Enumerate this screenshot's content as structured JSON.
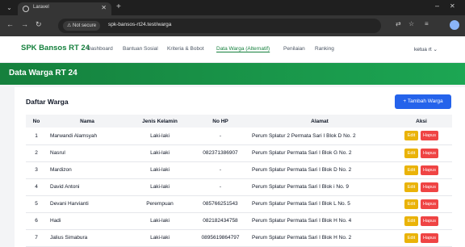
{
  "browser": {
    "tab_title": "Laravel",
    "security_label": "Not secure",
    "url": "spk-bansos-rt24.test/warga"
  },
  "nav": {
    "brand": "SPK Bansos RT 24",
    "links": [
      {
        "label": "Dashboard",
        "active": false
      },
      {
        "label": "Bantuan Sosial",
        "active": false
      },
      {
        "label": "Kriteria & Bobot",
        "active": false
      },
      {
        "label": "Data Warga (Alternatif)",
        "active": true
      },
      {
        "label": "Penilaian",
        "active": false
      },
      {
        "label": "Ranking",
        "active": false
      }
    ],
    "user": "ketua rt"
  },
  "header": {
    "title": "Data Warga RT 24"
  },
  "card": {
    "title": "Daftar Warga",
    "add_button": "+ Tambah Warga",
    "columns": [
      "No",
      "Nama",
      "Jenis Kelamin",
      "No HP",
      "Alamat",
      "Aksi"
    ],
    "edit_label": "Edit",
    "delete_label": "Hapus",
    "rows": [
      {
        "no": "1",
        "nama": "Marwandi Alamsyah",
        "jk": "Laki-laki",
        "hp": "-",
        "alamat": "Perum Splatur 2 Permata Sari I Blok D No. 2"
      },
      {
        "no": "2",
        "nama": "Nasrul",
        "jk": "Laki-laki",
        "hp": "082371386907",
        "alamat": "Perum Splatur Permata Sari I Blok G No. 2"
      },
      {
        "no": "3",
        "nama": "Mardizon",
        "jk": "Laki-laki",
        "hp": "-",
        "alamat": "Perum Splatur Permata Sari I Blok D No. 2"
      },
      {
        "no": "4",
        "nama": "David Antoni",
        "jk": "Laki-laki",
        "hp": "-",
        "alamat": "Perum Splatur Permata Sari I Blok i No. 9"
      },
      {
        "no": "5",
        "nama": "Devani Harvianti",
        "jk": "Perempuan",
        "hp": "085766251543",
        "alamat": "Perum Splatur Permata Sari I Blok L No. 5"
      },
      {
        "no": "6",
        "nama": "Hadi",
        "jk": "Laki-laki",
        "hp": "082182434758",
        "alamat": "Perum Splatur Permata Sari I Blok H No. 4"
      },
      {
        "no": "7",
        "nama": "Jalius Simabura",
        "jk": "Laki-laki",
        "hp": "0895619864797",
        "alamat": "Perum Splatur Permata Sari I Blok H No. 2"
      }
    ]
  },
  "colors": {
    "brand_green": "#15803d",
    "primary_blue": "#2563eb",
    "edit_yellow": "#eab308",
    "delete_red": "#ef4444"
  }
}
